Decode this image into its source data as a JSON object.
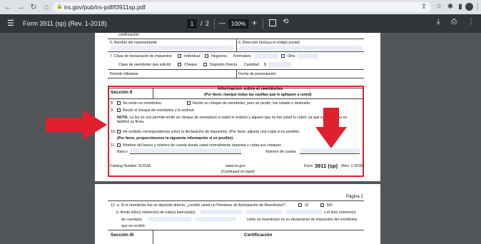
{
  "browser": {
    "url": "irs.gov/pub/irs-pdf/f3911sp.pdf",
    "icons": [
      "back-icon",
      "forward-icon",
      "reload-icon",
      "home-icon",
      "lock-icon",
      "share-icon",
      "star-icon",
      "extensions-icon",
      "sidepanel-icon",
      "avatar",
      "menu-icon"
    ]
  },
  "pdf_toolbar": {
    "title": "Form 3911 (sp) (Rev. 1-2018)",
    "page_current": "1",
    "page_sep": "/",
    "page_total": "2",
    "zoom": "100%",
    "minus": "—",
    "plus": "+"
  },
  "page1": {
    "continuacion": "continuación",
    "rep_name": "5. Nombre del representante",
    "address": "6. Dirección (incluya el código postal)",
    "tax_return_type": "7. Clase de declaración de impuestos",
    "individual": "Individual",
    "negocios": "Negocios,",
    "formulario": "Formulario",
    "otra": "Otra",
    "refund_type": "Clase de reembolso que solicitó",
    "cheque": "Cheque",
    "deposito": "Depósito Directo",
    "cantidad": "Cantidad",
    "dollar": "$",
    "periodo": "Periodo tributario",
    "fecha": "Fecha de presentación",
    "section_title": "Sección II",
    "section_heading": "Información sobre el reembolso",
    "section_sub": "(Por favor, marque todas las casillas que le apliquen a usted)",
    "l8n": "8.",
    "l8a": "No recibí un reembolso.",
    "l8b": "Recibí un cheque de reembolso, pero se perdió, fue robado o destruido.",
    "l9n": "9.",
    "l9": "Recibí el cheque de reembolso y lo endosé.",
    "nota_b": "NOTA:",
    "nota": " La ley no nos permite emitir un cheque de reemplazo si usted lo endosó y alguien que no fue usted lo cobró, ya que esta persona no falsificó su firma.",
    "l10n": "10.",
    "l10": "He recibido correspondencia sobre la declaración de impuestos. (Por favor, adjunte una copia si es posible).",
    "l10b": "(Por favor, proporciónenos la siguiente información si es posible).",
    "l11n": "11.",
    "l11": "Nombre del banco y número de cuenta donde usted normalmente deposita o cobra sus cheques",
    "banco": "Banco",
    "cuenta": "Número de cuenta",
    "catalog": "Catalog Number 31331A",
    "website": "www.irs.gov",
    "continued": "(Continued on back)",
    "form_pre": "Form",
    "form_num": "3911 (sp)",
    "form_rev": "(Rev. 1-2018)"
  },
  "page2": {
    "pagina": "Página 2",
    "l12": "12. a. Si el reembolso fue un depósito directo, ¿recibió usted un Préstamo de Anticipación de Reembolso?",
    "si": "SÍ",
    "no": "NO",
    "l12b": "b. Anote el(los) número(s) de ruta(s) bancaria(s)",
    "l12b2": "y el (los) número(s)",
    "l12c": "de cuenta(s)",
    "l12c2": "como se muestra(n) en su declaración de impuestos del reembolso",
    "l12d": "que no recibió.",
    "section3": "Sección III",
    "cert": "Certificación"
  },
  "annotations": {
    "arrow_color": "#e0202e",
    "box_color": "#e0202e"
  }
}
